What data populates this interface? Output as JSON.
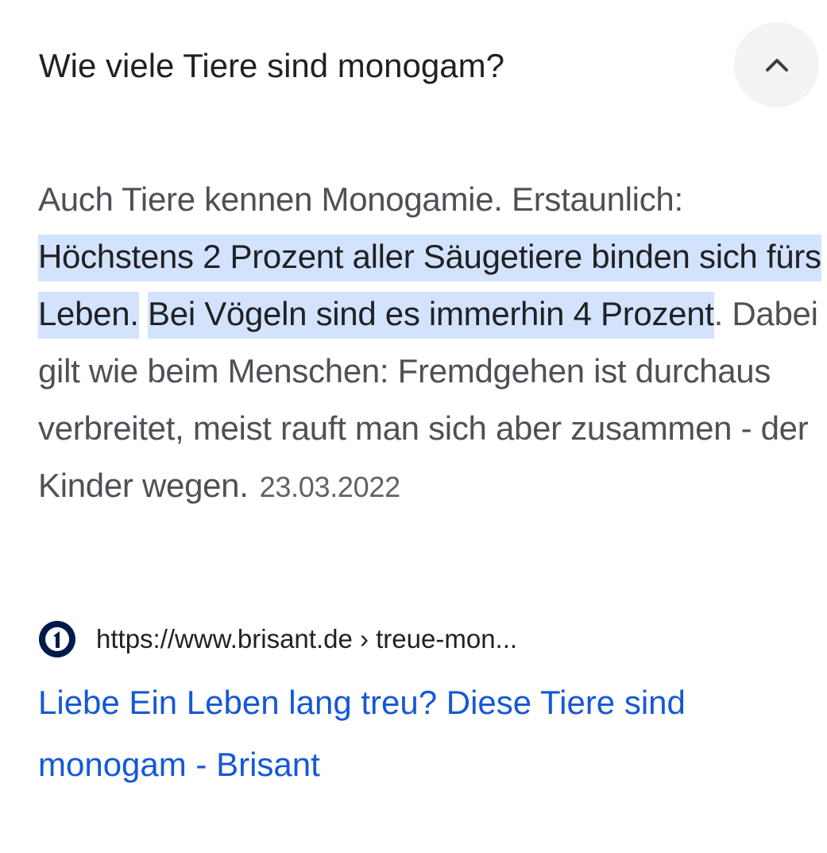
{
  "question": {
    "title": "Wie viele Tiere sind monogam?",
    "toggle_icon": "chevron-up-icon"
  },
  "answer": {
    "intro": "Auch Tiere kennen Monogamie. Erstaunlich: ",
    "highlight_1": "Höchstens 2 Prozent aller Säugetiere binden sich fürs Leben.",
    "highlight_2": "Bei Vögeln sind es immerhin 4 Prozent",
    "rest": ". Dabei gilt wie beim Menschen: Fremdgehen ist durchaus verbreitet, meist rauft man sich aber zusammen - der Kinder wegen.",
    "date": "23.03.2022",
    "highlight_color": "#d3e3fd"
  },
  "source": {
    "logo_icon": "das-erste-logo-icon",
    "url": "https://www.brisant.de › treue-mon...",
    "title": "Liebe Ein Leben lang treu? Diese Tiere sind monogam - Brisant",
    "link_color": "#1558d6"
  }
}
